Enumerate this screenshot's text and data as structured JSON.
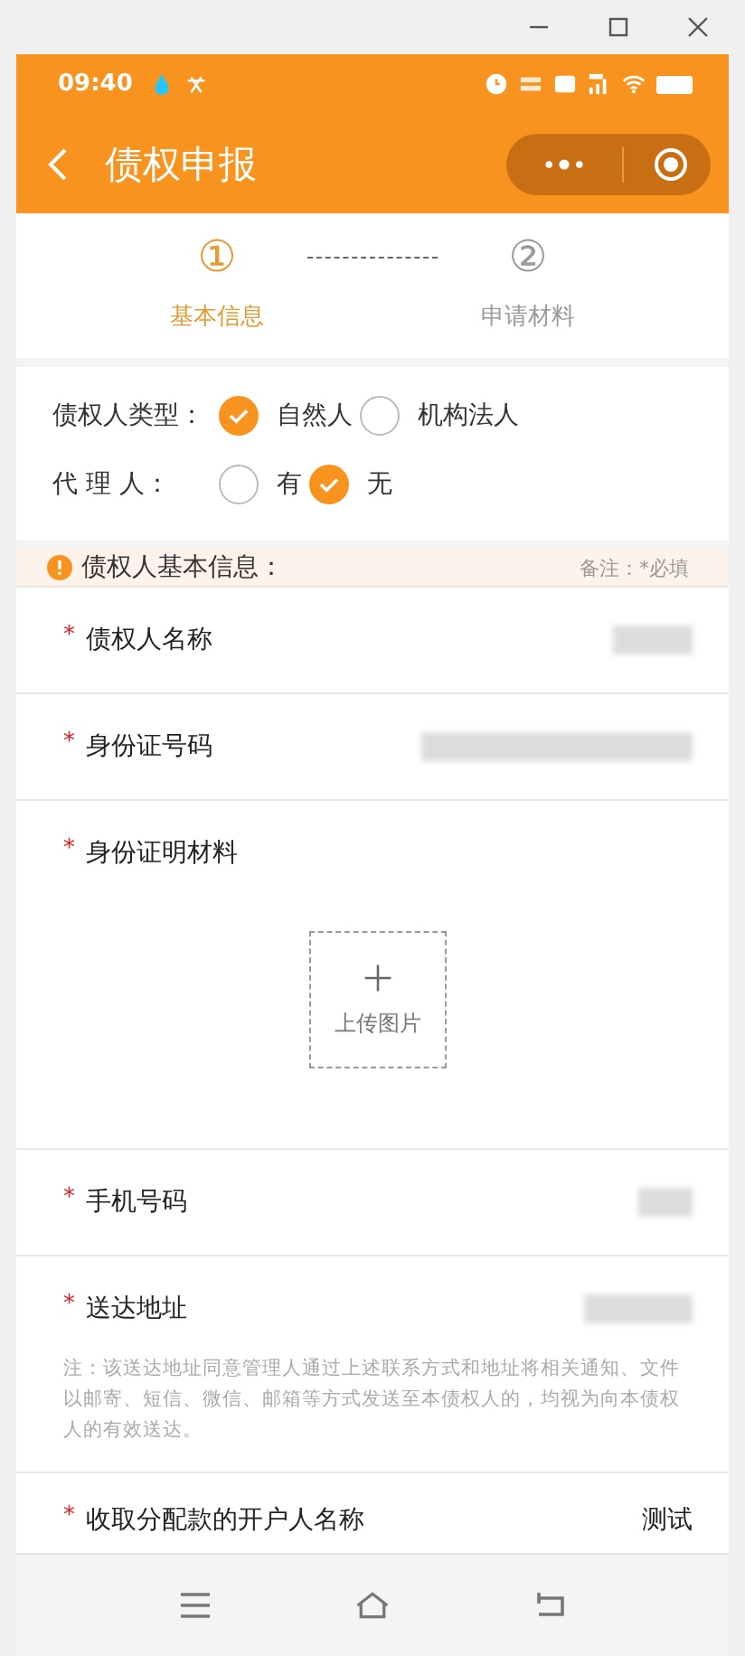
{
  "status_bar": {
    "time": "09:40"
  },
  "nav": {
    "title": "债权申报"
  },
  "steps": [
    {
      "number": "①",
      "label": "基本信息",
      "selected": true
    },
    {
      "number": "②",
      "label": "申请材料",
      "selected": false
    }
  ],
  "radio_groups": [
    {
      "label": "债权人类型：",
      "options": [
        {
          "label": "自然人",
          "checked": true
        },
        {
          "label": "机构法人",
          "checked": false
        }
      ]
    },
    {
      "label": "代 理 人：",
      "options": [
        {
          "label": "有",
          "checked": false
        },
        {
          "label": "无",
          "checked": true
        }
      ]
    }
  ],
  "section": {
    "title": "债权人基本信息：",
    "note": "备注：*必填"
  },
  "fields": [
    {
      "kind": "masked",
      "marker": "*",
      "label": "债权人名称"
    },
    {
      "kind": "masked",
      "marker": "*",
      "label": "身份证号码"
    },
    {
      "kind": "upload",
      "marker": "*",
      "label": "身份证明材料",
      "button_label": "上传图片"
    },
    {
      "kind": "masked",
      "marker": "*",
      "label": "手机号码"
    },
    {
      "kind": "masked",
      "marker": "*",
      "label": "送达地址",
      "note": "注：该送达地址同意管理人通过上述联系方式和地址将相关通知、文件以邮寄、短信、微信、邮箱等方式发送至本债权人的，均视为向本债权人的有效送达。"
    },
    {
      "kind": "text",
      "marker": "*",
      "label": "收取分配款的开户人名称",
      "value": "测试"
    }
  ]
}
